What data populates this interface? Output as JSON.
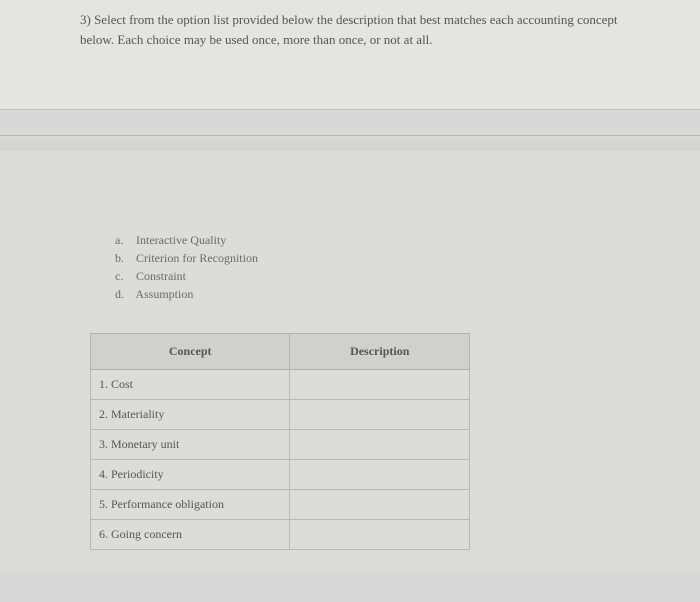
{
  "question": {
    "text": "3) Select from the option list provided below the description that best matches each accounting concept below. Each choice may be used once, more than once, or not at all."
  },
  "options": [
    {
      "marker": "a.",
      "label": "Interactive Quality"
    },
    {
      "marker": "b.",
      "label": "Criterion for Recognition"
    },
    {
      "marker": "c.",
      "label": "Constraint"
    },
    {
      "marker": "d.",
      "label": "Assumption"
    }
  ],
  "table": {
    "headers": {
      "concept": "Concept",
      "description": "Description"
    },
    "rows": [
      {
        "concept": "1. Cost",
        "description": ""
      },
      {
        "concept": "2. Materiality",
        "description": ""
      },
      {
        "concept": "3. Monetary unit",
        "description": ""
      },
      {
        "concept": "4. Periodicity",
        "description": ""
      },
      {
        "concept": "5. Performance obligation",
        "description": ""
      },
      {
        "concept": "6. Going concern",
        "description": ""
      }
    ]
  }
}
